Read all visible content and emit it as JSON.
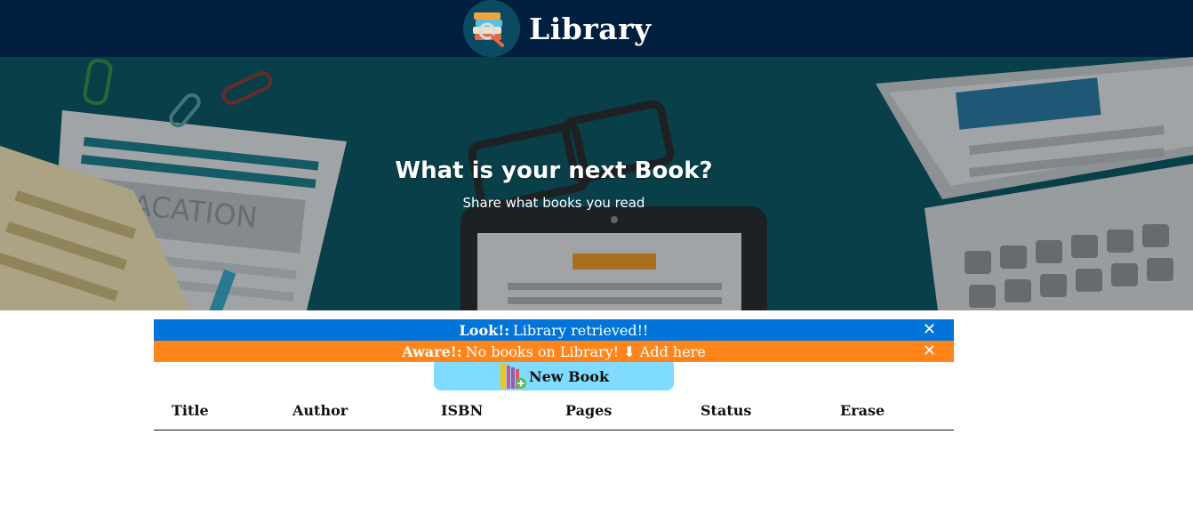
{
  "header": {
    "title": "Library",
    "logo_icon": "books-magnifier-icon",
    "background": "#001f3f"
  },
  "hero": {
    "title": "What is your next Book?",
    "subtitle": "Share what books you read"
  },
  "alerts": [
    {
      "strong": "Look!:",
      "text": "Library retrieved!!",
      "color": "#0074d9",
      "close": "✕"
    },
    {
      "strong": "Aware!:",
      "text": "No books on Library! ⬇ Add here",
      "color": "#ff851b",
      "close": "✕"
    }
  ],
  "new_book": {
    "label": "New Book",
    "icon": "add-book-icon",
    "color": "#7fdbff"
  },
  "table": {
    "columns": [
      "Title",
      "Author",
      "ISBN",
      "Pages",
      "Status",
      "Erase"
    ],
    "rows": []
  }
}
